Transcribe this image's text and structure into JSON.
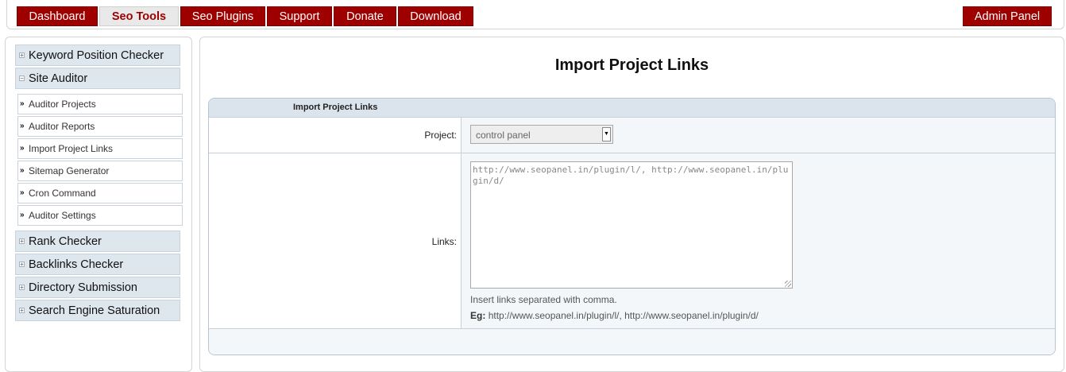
{
  "nav": {
    "items": [
      {
        "label": "Dashboard",
        "active": false
      },
      {
        "label": "Seo Tools",
        "active": true
      },
      {
        "label": "Seo Plugins",
        "active": false
      },
      {
        "label": "Support",
        "active": false
      },
      {
        "label": "Donate",
        "active": false
      },
      {
        "label": "Download",
        "active": false
      }
    ],
    "admin_label": "Admin Panel"
  },
  "sidebar": {
    "groups": [
      {
        "label": "Keyword Position Checker",
        "expanded": false
      },
      {
        "label": "Site Auditor",
        "expanded": true,
        "items": [
          "Auditor Projects",
          "Auditor Reports",
          "Import Project Links",
          "Sitemap Generator",
          "Cron Command",
          "Auditor Settings"
        ]
      },
      {
        "label": "Rank Checker",
        "expanded": false
      },
      {
        "label": "Backlinks Checker",
        "expanded": false
      },
      {
        "label": "Directory Submission",
        "expanded": false
      },
      {
        "label": "Search Engine Saturation",
        "expanded": false
      }
    ],
    "sign_plus": "+",
    "sign_minus": "−",
    "item_arrow": "»"
  },
  "main": {
    "title": "Import Project Links",
    "form": {
      "header": "Import Project Links",
      "project_label": "Project:",
      "project_value": "control panel",
      "links_label": "Links:",
      "links_placeholder": "http://www.seopanel.in/plugin/l/, http://www.seopanel.in/plugin/d/",
      "help_text": "Insert links separated with comma.",
      "example_label": "Eg:",
      "example_text": "http://www.seopanel.in/plugin/l/, http://www.seopanel.in/plugin/d/"
    }
  },
  "colors": {
    "brand": "#9e0000",
    "panel_header": "#dbe4ec",
    "menu_head": "#dee6ee"
  },
  "icons": {
    "dropdown_caret": "chevron-down-icon"
  }
}
